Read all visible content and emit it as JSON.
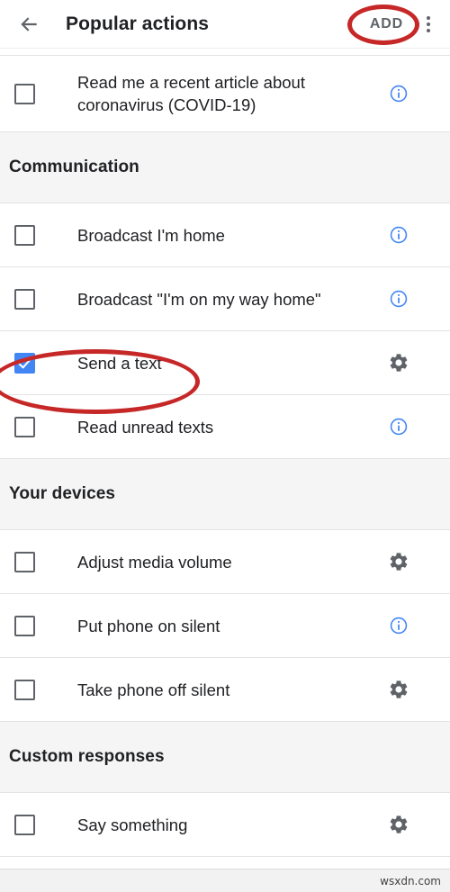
{
  "appbar": {
    "back_icon": "arrow-back-icon",
    "title": "Popular actions",
    "add_label": "ADD",
    "overflow_icon": "more-vert-icon"
  },
  "colors": {
    "accent_blue": "#4285f4",
    "info_blue": "#4285f4",
    "icon_gray": "#5f6368",
    "section_bg": "#f5f5f5",
    "annotation_red": "#c62828",
    "text": "#202124"
  },
  "annotations": [
    {
      "name": "add-button-highlight",
      "shape": "ellipse",
      "target": "ADD"
    },
    {
      "name": "send-a-text-highlight",
      "shape": "ellipse",
      "target": "Send a text"
    }
  ],
  "list": [
    {
      "kind": "item",
      "label": "Read me a recent article about coronavirus (COVID-19)",
      "checked": false,
      "trailing": "info-icon",
      "tall": true
    },
    {
      "kind": "section",
      "label": "Communication"
    },
    {
      "kind": "item",
      "label": "Broadcast I'm home",
      "checked": false,
      "trailing": "info-icon",
      "tall": false
    },
    {
      "kind": "item",
      "label": "Broadcast \"I'm on my way home\"",
      "checked": false,
      "trailing": "info-icon",
      "tall": false
    },
    {
      "kind": "item",
      "label": "Send a text",
      "checked": true,
      "trailing": "gear-icon",
      "tall": false
    },
    {
      "kind": "item",
      "label": "Read unread texts",
      "checked": false,
      "trailing": "info-icon",
      "tall": false
    },
    {
      "kind": "section",
      "label": "Your devices"
    },
    {
      "kind": "item",
      "label": "Adjust media volume",
      "checked": false,
      "trailing": "gear-icon",
      "tall": false
    },
    {
      "kind": "item",
      "label": "Put phone on silent",
      "checked": false,
      "trailing": "info-icon",
      "tall": false
    },
    {
      "kind": "item",
      "label": "Take phone off silent",
      "checked": false,
      "trailing": "gear-icon",
      "tall": false
    },
    {
      "kind": "section",
      "label": "Custom responses"
    },
    {
      "kind": "item",
      "label": "Say something",
      "checked": false,
      "trailing": "gear-icon",
      "tall": false
    }
  ],
  "footer": {
    "watermark": "wsxdn.com"
  }
}
